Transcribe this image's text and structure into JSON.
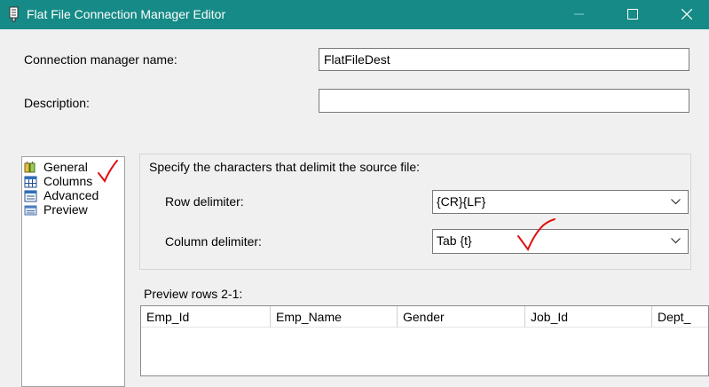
{
  "window": {
    "title": "Flat File Connection Manager Editor"
  },
  "form": {
    "name_label": "Connection manager name:",
    "name_value": "FlatFileDest",
    "description_label": "Description:",
    "description_value": ""
  },
  "nav": {
    "items": [
      {
        "label": "General",
        "icon": "general-icon"
      },
      {
        "label": "Columns",
        "icon": "columns-icon"
      },
      {
        "label": "Advanced",
        "icon": "advanced-icon"
      },
      {
        "label": "Preview",
        "icon": "preview-icon"
      }
    ]
  },
  "columns_page": {
    "group_title": "Specify the characters that delimit the source file:",
    "row_delimiter_label": "Row delimiter:",
    "row_delimiter_value": "{CR}{LF}",
    "column_delimiter_label": "Column delimiter:",
    "column_delimiter_value": "Tab {t}",
    "preview_label": "Preview rows 2-1:",
    "preview_columns": [
      "Emp_Id",
      "Emp_Name",
      "Gender",
      "Job_Id",
      "Dept_"
    ]
  },
  "colors": {
    "titlebar": "#168a86",
    "annotation": "#e01010"
  }
}
